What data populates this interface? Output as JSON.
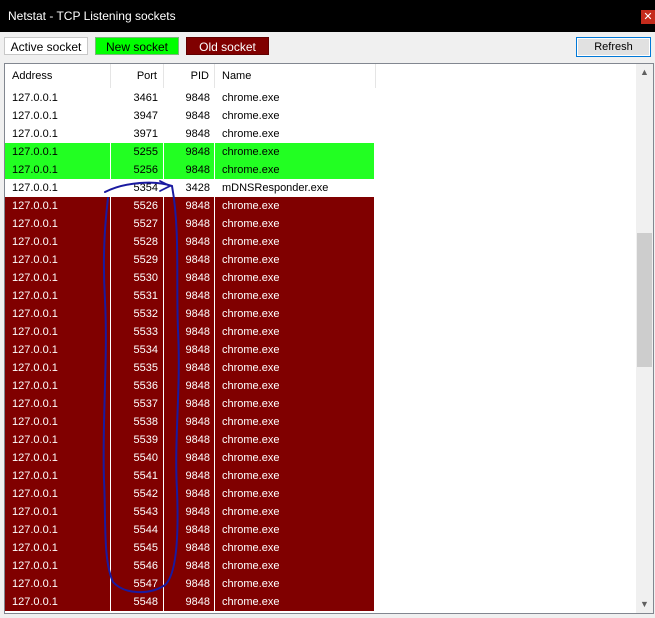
{
  "window": {
    "title": "Netstat - TCP Listening sockets",
    "close_glyph": "✕"
  },
  "legend": {
    "active": "Active socket",
    "new": "New socket",
    "old": "Old socket"
  },
  "toolbar": {
    "refresh_label": "Refresh"
  },
  "colors": {
    "active": "#ffffff",
    "new": "#22ff22",
    "old": "#800000",
    "annotation": "#1a1aa0"
  },
  "table": {
    "columns": [
      "Address",
      "Port",
      "PID",
      "Name"
    ],
    "rows": [
      {
        "address": "127.0.0.1",
        "port": "3461",
        "pid": "9848",
        "name": "chrome.exe",
        "status": "active"
      },
      {
        "address": "127.0.0.1",
        "port": "3947",
        "pid": "9848",
        "name": "chrome.exe",
        "status": "active"
      },
      {
        "address": "127.0.0.1",
        "port": "3971",
        "pid": "9848",
        "name": "chrome.exe",
        "status": "active"
      },
      {
        "address": "127.0.0.1",
        "port": "5255",
        "pid": "9848",
        "name": "chrome.exe",
        "status": "new"
      },
      {
        "address": "127.0.0.1",
        "port": "5256",
        "pid": "9848",
        "name": "chrome.exe",
        "status": "new"
      },
      {
        "address": "127.0.0.1",
        "port": "5354",
        "pid": "3428",
        "name": "mDNSResponder.exe",
        "status": "active"
      },
      {
        "address": "127.0.0.1",
        "port": "5526",
        "pid": "9848",
        "name": "chrome.exe",
        "status": "old"
      },
      {
        "address": "127.0.0.1",
        "port": "5527",
        "pid": "9848",
        "name": "chrome.exe",
        "status": "old"
      },
      {
        "address": "127.0.0.1",
        "port": "5528",
        "pid": "9848",
        "name": "chrome.exe",
        "status": "old"
      },
      {
        "address": "127.0.0.1",
        "port": "5529",
        "pid": "9848",
        "name": "chrome.exe",
        "status": "old"
      },
      {
        "address": "127.0.0.1",
        "port": "5530",
        "pid": "9848",
        "name": "chrome.exe",
        "status": "old"
      },
      {
        "address": "127.0.0.1",
        "port": "5531",
        "pid": "9848",
        "name": "chrome.exe",
        "status": "old"
      },
      {
        "address": "127.0.0.1",
        "port": "5532",
        "pid": "9848",
        "name": "chrome.exe",
        "status": "old"
      },
      {
        "address": "127.0.0.1",
        "port": "5533",
        "pid": "9848",
        "name": "chrome.exe",
        "status": "old"
      },
      {
        "address": "127.0.0.1",
        "port": "5534",
        "pid": "9848",
        "name": "chrome.exe",
        "status": "old"
      },
      {
        "address": "127.0.0.1",
        "port": "5535",
        "pid": "9848",
        "name": "chrome.exe",
        "status": "old"
      },
      {
        "address": "127.0.0.1",
        "port": "5536",
        "pid": "9848",
        "name": "chrome.exe",
        "status": "old"
      },
      {
        "address": "127.0.0.1",
        "port": "5537",
        "pid": "9848",
        "name": "chrome.exe",
        "status": "old"
      },
      {
        "address": "127.0.0.1",
        "port": "5538",
        "pid": "9848",
        "name": "chrome.exe",
        "status": "old"
      },
      {
        "address": "127.0.0.1",
        "port": "5539",
        "pid": "9848",
        "name": "chrome.exe",
        "status": "old"
      },
      {
        "address": "127.0.0.1",
        "port": "5540",
        "pid": "9848",
        "name": "chrome.exe",
        "status": "old"
      },
      {
        "address": "127.0.0.1",
        "port": "5541",
        "pid": "9848",
        "name": "chrome.exe",
        "status": "old"
      },
      {
        "address": "127.0.0.1",
        "port": "5542",
        "pid": "9848",
        "name": "chrome.exe",
        "status": "old"
      },
      {
        "address": "127.0.0.1",
        "port": "5543",
        "pid": "9848",
        "name": "chrome.exe",
        "status": "old"
      },
      {
        "address": "127.0.0.1",
        "port": "5544",
        "pid": "9848",
        "name": "chrome.exe",
        "status": "old"
      },
      {
        "address": "127.0.0.1",
        "port": "5545",
        "pid": "9848",
        "name": "chrome.exe",
        "status": "old"
      },
      {
        "address": "127.0.0.1",
        "port": "5546",
        "pid": "9848",
        "name": "chrome.exe",
        "status": "old"
      },
      {
        "address": "127.0.0.1",
        "port": "5547",
        "pid": "9848",
        "name": "chrome.exe",
        "status": "old"
      },
      {
        "address": "127.0.0.1",
        "port": "5548",
        "pid": "9848",
        "name": "chrome.exe",
        "status": "old"
      }
    ]
  },
  "scrollbar": {
    "up_glyph": "▲",
    "down_glyph": "▼"
  }
}
